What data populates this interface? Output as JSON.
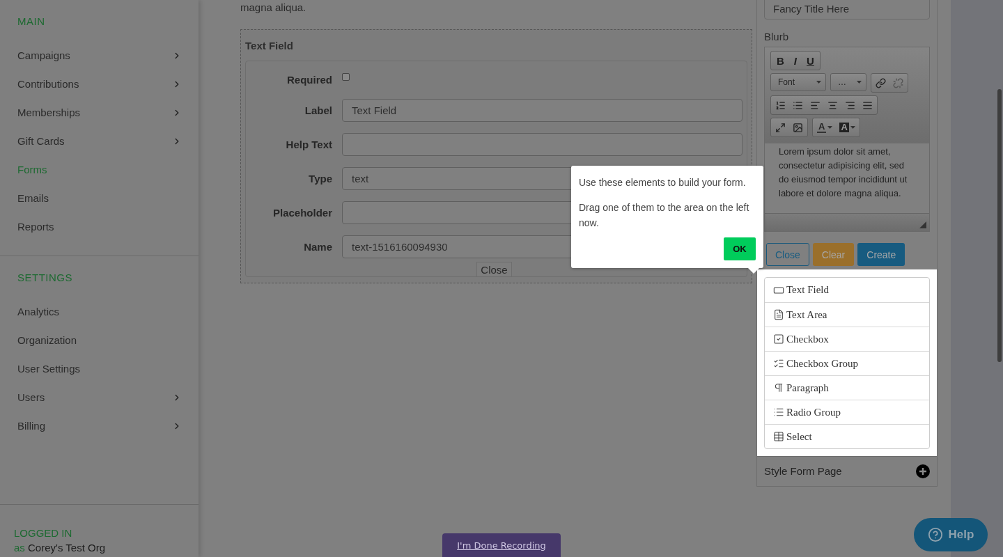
{
  "sidebar": {
    "sections": [
      {
        "heading": "MAIN",
        "items": [
          {
            "label": "Campaigns",
            "selected": false,
            "has_submenu": true
          },
          {
            "label": "Contributions",
            "selected": false,
            "has_submenu": true
          },
          {
            "label": "Memberships",
            "selected": false,
            "has_submenu": true
          },
          {
            "label": "Gift Cards",
            "selected": false,
            "has_submenu": true
          },
          {
            "label": "Forms",
            "selected": true,
            "has_submenu": false
          },
          {
            "label": "Emails",
            "selected": false,
            "has_submenu": false
          },
          {
            "label": "Reports",
            "selected": false,
            "has_submenu": false
          }
        ]
      },
      {
        "heading": "SETTINGS",
        "items": [
          {
            "label": "Analytics",
            "selected": false,
            "has_submenu": false
          },
          {
            "label": "Organization",
            "selected": false,
            "has_submenu": false
          },
          {
            "label": "User Settings",
            "selected": false,
            "has_submenu": false
          },
          {
            "label": "Users",
            "selected": false,
            "has_submenu": true
          },
          {
            "label": "Billing",
            "selected": false,
            "has_submenu": true
          }
        ]
      }
    ],
    "footer": {
      "status": "LOGGED IN",
      "prefix": "as",
      "org": "Corey's Test Org"
    }
  },
  "intro_text": "magna aliqua.",
  "field_editor": {
    "title": "Text Field",
    "rows": [
      {
        "kind": "checkbox",
        "label": "Required",
        "checked": false
      },
      {
        "kind": "input",
        "label": "Label",
        "value": "Text Field"
      },
      {
        "kind": "input",
        "label": "Help Text"
      },
      {
        "kind": "input",
        "label": "Type",
        "value": "text"
      },
      {
        "kind": "input",
        "label": "Placeholder"
      },
      {
        "kind": "input",
        "label": "Name",
        "value": "text-1516160094930"
      }
    ],
    "close": "Close"
  },
  "side_panel": {
    "title_value": "Fancy Title Here",
    "blurb_label": "Blurb",
    "toolbar": {
      "style_buttons": [
        "B",
        "I",
        "U"
      ],
      "font": "Font",
      "size": "…",
      "color_buttons": [
        "A",
        "A"
      ]
    },
    "blurb_text": "Lorem ipsum dolor sit amet, consectetur adipisicing elit, sed do eiusmod tempor incididunt ut labore et dolore magna aliqua.",
    "buttons": [
      {
        "label": "Close",
        "kind": "outline"
      },
      {
        "label": "Clear",
        "kind": "warning"
      },
      {
        "label": "Create",
        "kind": "primary"
      }
    ],
    "elements": [
      {
        "label": "Text Field",
        "kind": "text-field"
      },
      {
        "label": "Text Area",
        "kind": "text-area"
      },
      {
        "label": "Checkbox",
        "kind": "checkbox"
      },
      {
        "label": "Checkbox Group",
        "kind": "checkbox-group"
      },
      {
        "label": "Paragraph",
        "kind": "paragraph"
      },
      {
        "label": "Radio Group",
        "kind": "radio-group"
      },
      {
        "label": "Select",
        "kind": "select"
      }
    ],
    "style_page": "Style Form Page"
  },
  "tour": {
    "lines": [
      "Use these elements to build your form.",
      "Drag one of them to the area on the left now."
    ],
    "ok": "OK"
  },
  "recording_button": "I'm Done Recording",
  "help_button": "Help"
}
